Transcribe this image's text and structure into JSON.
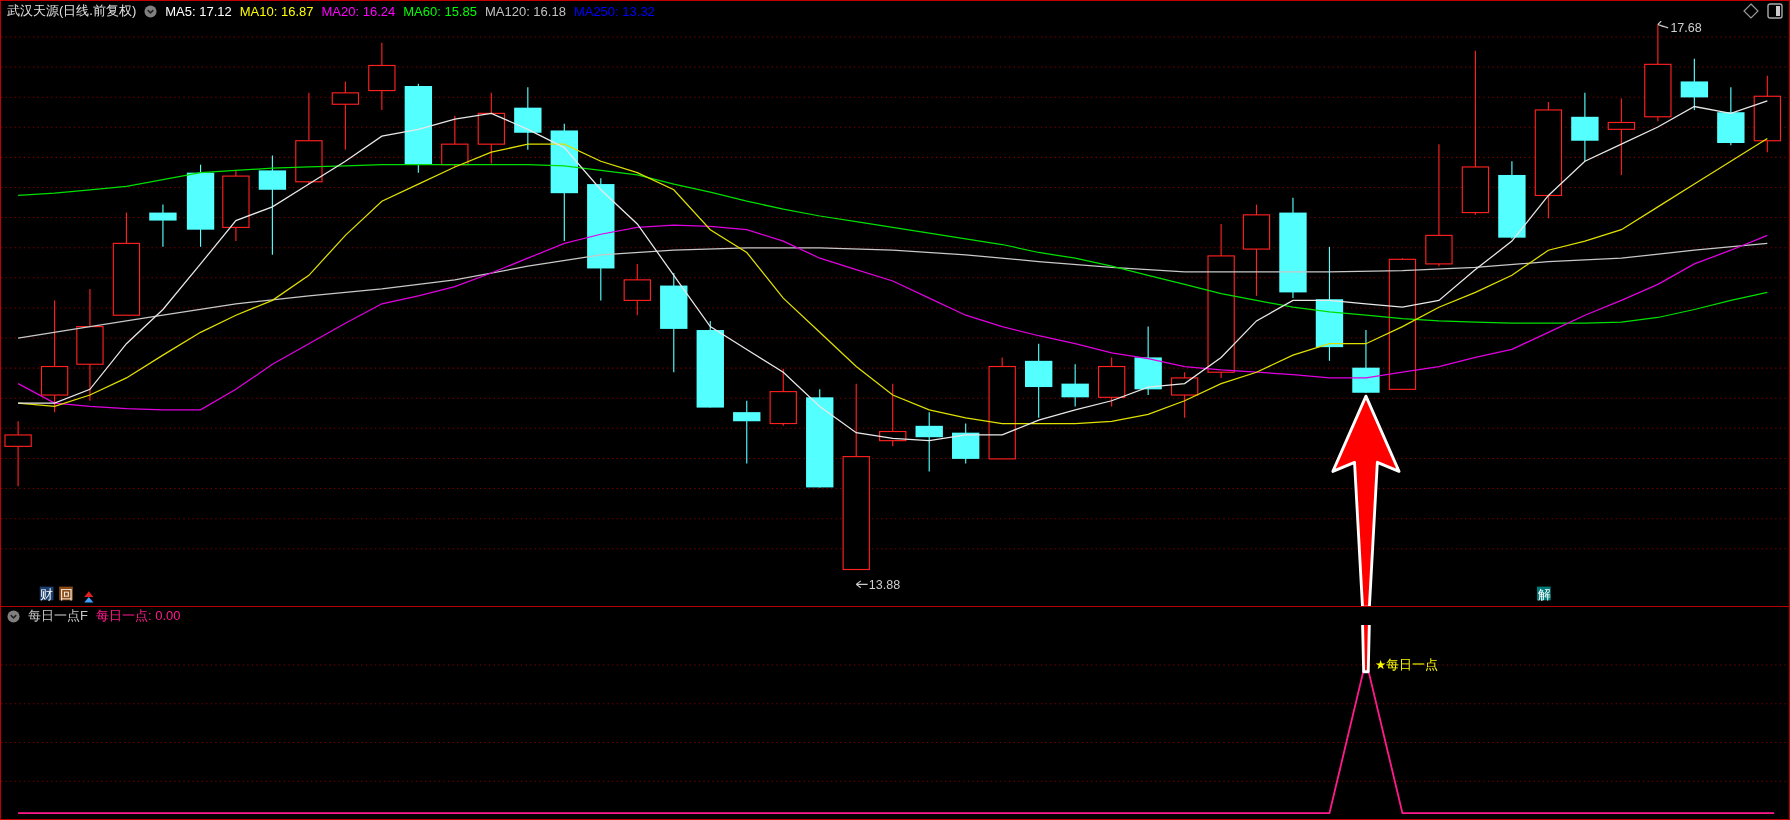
{
  "header": {
    "title": "武汉天源(日线.前复权)",
    "ma_items": [
      {
        "label": "MA5: 17.12",
        "color": "#ffffff"
      },
      {
        "label": "MA10: 16.87",
        "color": "#ffff00"
      },
      {
        "label": "MA20: 16.24",
        "color": "#ff00ff"
      },
      {
        "label": "MA60: 15.85",
        "color": "#00ff00"
      },
      {
        "label": "MA120: 16.18",
        "color": "#c0c0c0"
      },
      {
        "label": "MA250: 13.32",
        "color": "#0000ff"
      }
    ]
  },
  "price_chart": {
    "high_label": "17.68",
    "low_label": "13.88",
    "markers": [
      {
        "text": "财",
        "color": "#1c3f6e"
      },
      {
        "text": "回",
        "color": "#8a4a12"
      },
      {
        "text": "解",
        "color": "#007b7b"
      }
    ]
  },
  "indicator": {
    "name": "每日一点F",
    "reading": "每日一点: 0.00",
    "signal_label": "★每日一点"
  }
}
